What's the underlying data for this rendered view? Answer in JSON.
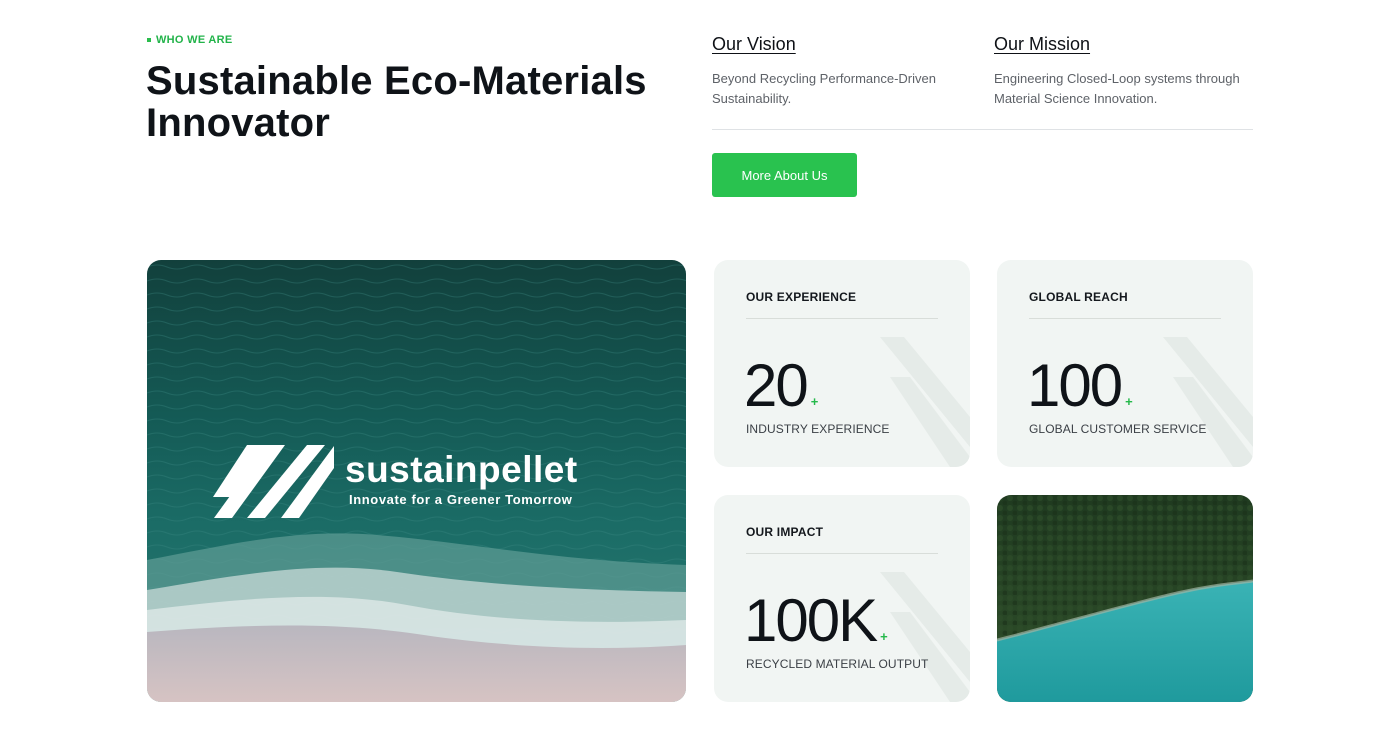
{
  "intro": {
    "eyebrow": "WHO WE ARE",
    "title": "Sustainable Eco-Materials Innovator"
  },
  "vision": {
    "heading": "Our Vision",
    "text": "Beyond Recycling Performance-Driven Sustainability."
  },
  "mission": {
    "heading": "Our Mission",
    "text": "Engineering Closed-Loop systems through Material Science Innovation."
  },
  "cta": {
    "label": "More About Us"
  },
  "brand": {
    "name": "sustainpellet",
    "tagline": "Innovate for a Greener Tomorrow"
  },
  "stats": [
    {
      "label": "OUR EXPERIENCE",
      "value": "20",
      "suffix": "+",
      "caption": "INDUSTRY EXPERIENCE"
    },
    {
      "label": "GLOBAL REACH",
      "value": "100",
      "suffix": "+",
      "caption": "GLOBAL CUSTOMER SERVICE"
    },
    {
      "label": "OUR IMPACT",
      "value": "100K",
      "suffix": "+",
      "caption": "RECYCLED MATERIAL OUTPUT"
    }
  ],
  "colors": {
    "accent": "#29c24f",
    "card_bg": "#f1f5f3",
    "heading": "#0f1318"
  }
}
